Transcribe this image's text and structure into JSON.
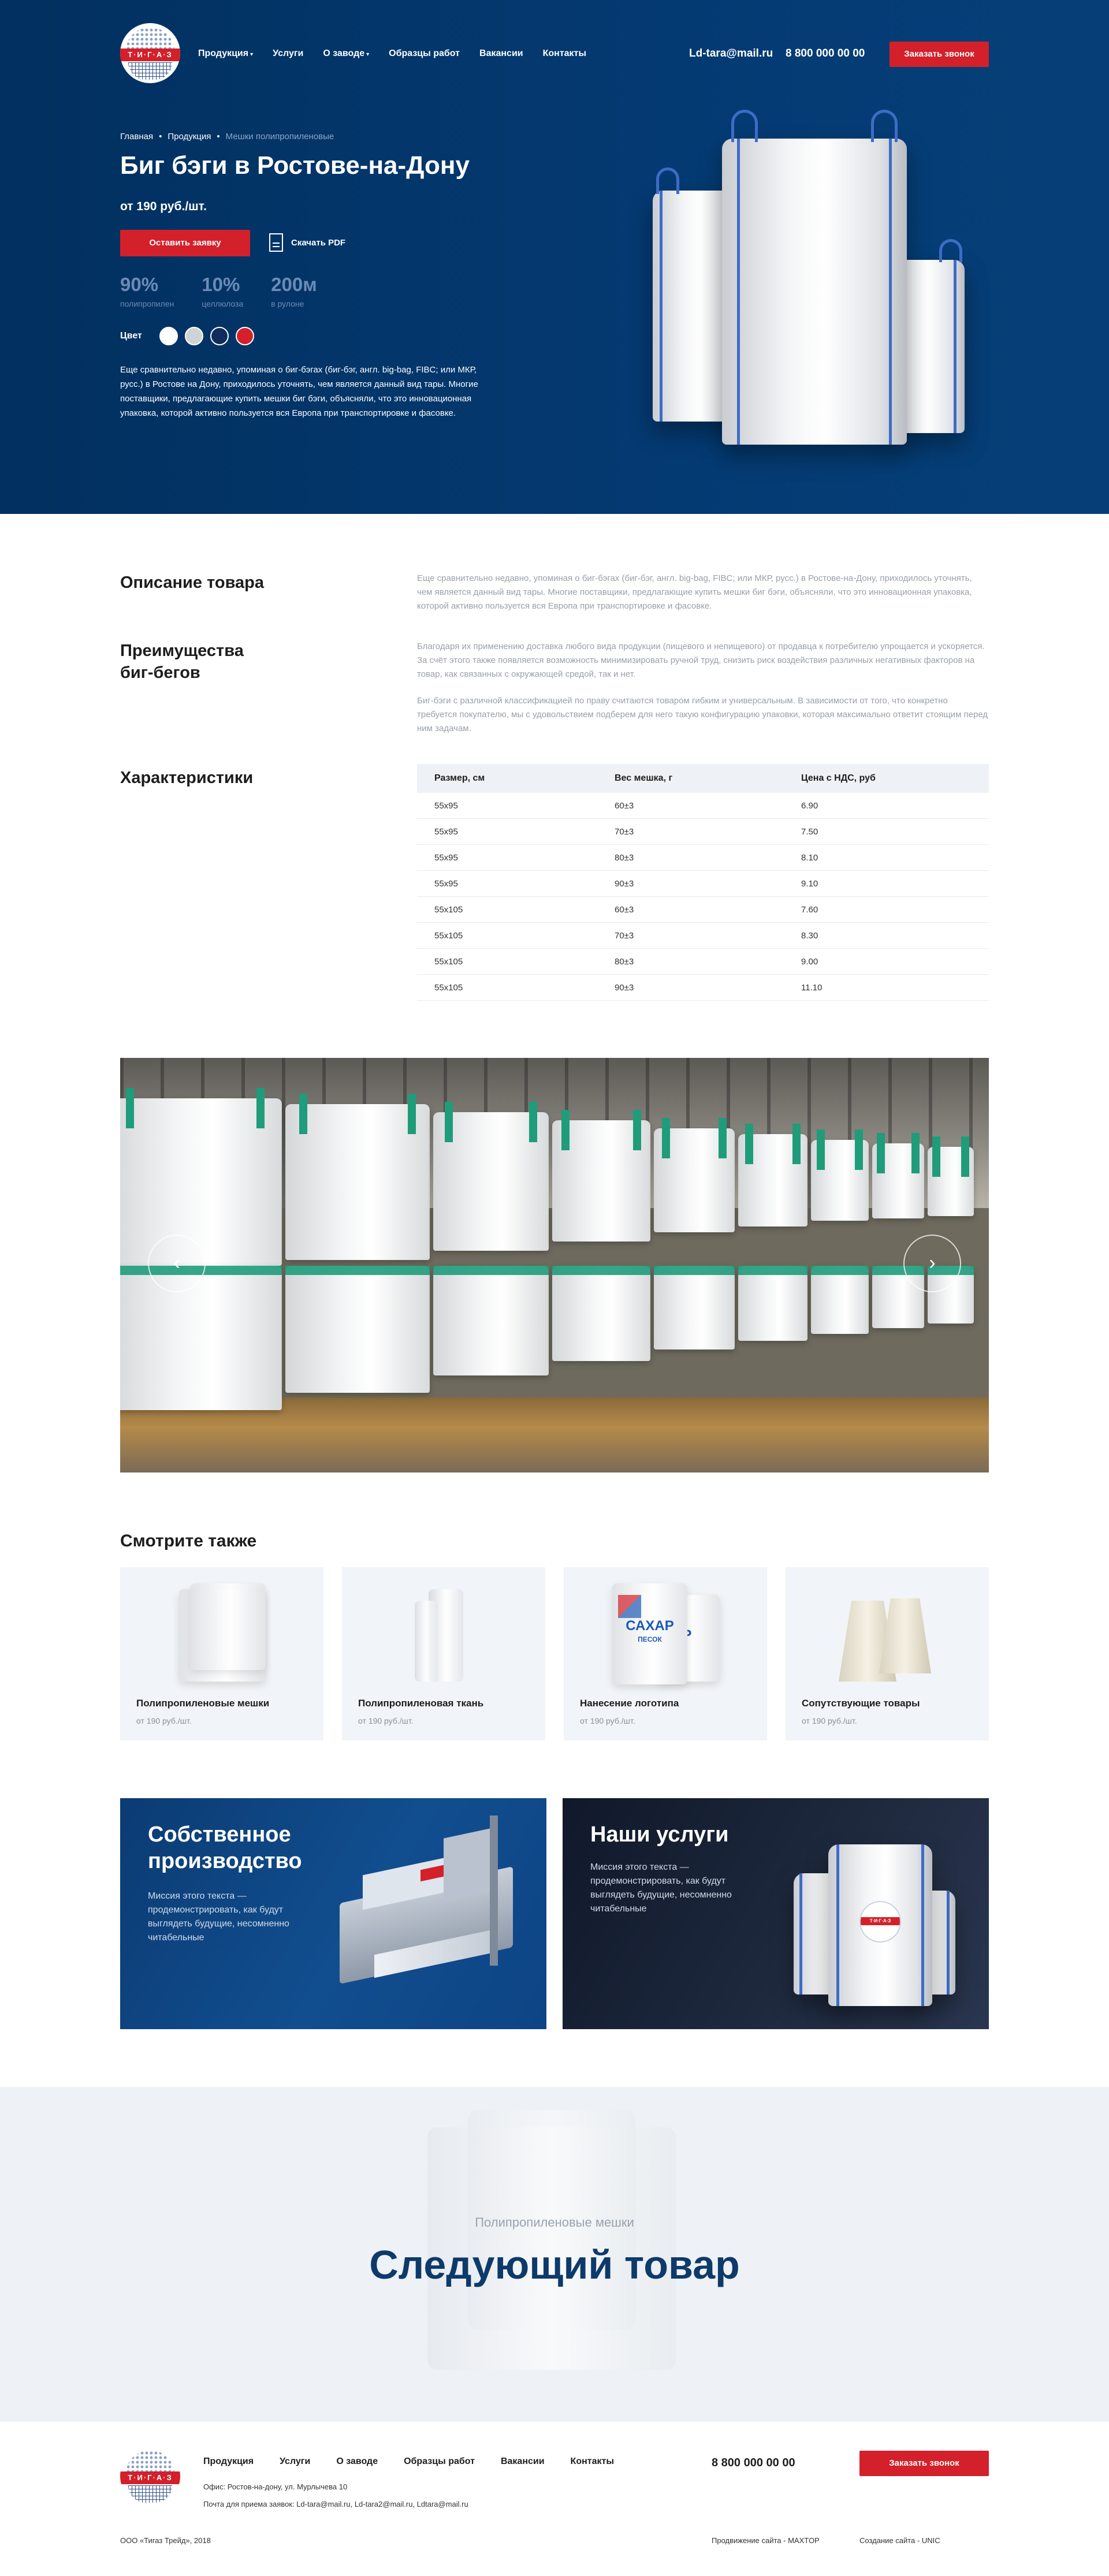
{
  "header": {
    "logo_text": "Т·И·Г·А·З",
    "nav": [
      {
        "label": "Продукция",
        "dropdown": true
      },
      {
        "label": "Услуги",
        "dropdown": false
      },
      {
        "label": "О заводе",
        "dropdown": true
      },
      {
        "label": "Образцы работ",
        "dropdown": false
      },
      {
        "label": "Вакансии",
        "dropdown": false
      },
      {
        "label": "Контакты",
        "dropdown": false
      }
    ],
    "email": "Ld-tara@mail.ru",
    "phone": "8 800 000 00 00",
    "call_button": "Заказать звонок"
  },
  "hero": {
    "breadcrumbs": [
      "Главная",
      "Продукция",
      "Мешки полипропиленовые"
    ],
    "title": "Биг бэги в Ростове-на-Дону",
    "price": "от 190 руб./шт.",
    "order_button": "Оставить заявку",
    "pdf_link": "Скачать PDF",
    "stats": [
      {
        "value": "90%",
        "label": "полипропилен"
      },
      {
        "value": "10%",
        "label": "целлюлоза"
      },
      {
        "value": "200м",
        "label": "в рулоне"
      }
    ],
    "color_label": "Цвет",
    "colors": [
      "#ffffff",
      "#cfd3d6",
      "#0e2d5c",
      "#d3202a"
    ],
    "description": "Еще сравнительно недавно, упоминая о биг-бэгах (биг-бэг, англ. big-bag, FIBC; или МКР, русс.) в Ростове на Дону, приходилось уточнять, чем является данный вид тары. Многие поставщики, предлагающие купить мешки биг бэги, объясняли, что это инновационная упаковка, которой активно пользуется вся Европа при транспортировке и фасовке."
  },
  "description_section": {
    "title": "Описание товара",
    "text": "Еще сравнительно недавно, упоминая о биг-бэгах (биг-бэг, англ. big-bag, FIBC; или МКР, русс.) в Ростове-на-Дону, приходилось уточнять, чем является данный вид тары. Многие поставщики, предлагающие купить мешки биг бэги, объясняли, что это инновационная упаковка, которой активно пользуется вся Европа при транспортировке и фасовке."
  },
  "advantages_section": {
    "title_line1": "Преимущества",
    "title_line2": "биг-бегов",
    "text1": "Благодаря их применению доставка любого вида продукции (пищевого и непищевого) от продавца к потребителю упрощается и ускоряется. За счёт этого также появляется возможность минимизировать ручной труд, снизить риск воздействия различных негативных факторов на товар, как связанных с окружающей средой, так и нет.",
    "text2": "Биг-бэги с различной классификацией по праву считаются товаром гибким и универсальным. В зависимости от того, что конкретно требуется покупателю, мы с удовольствием подберем для него такую конфигурацию упаковки, которая максимально ответит стоящим перед ним задачам."
  },
  "specs": {
    "title": "Характеристики",
    "columns": [
      "Размер, см",
      "Вес мешка, г",
      "Цена с НДС, руб"
    ],
    "rows": [
      [
        "55х95",
        "60±3",
        "6.90"
      ],
      [
        "55х95",
        "70±3",
        "7.50"
      ],
      [
        "55х95",
        "80±3",
        "8.10"
      ],
      [
        "55х95",
        "90±3",
        "9.10"
      ],
      [
        "55х105",
        "60±3",
        "7.60"
      ],
      [
        "55х105",
        "70±3",
        "8.30"
      ],
      [
        "55х105",
        "80±3",
        "9.00"
      ],
      [
        "55х105",
        "90±3",
        "11.10"
      ]
    ]
  },
  "gallery": {
    "prev": "‹",
    "next": "›"
  },
  "see_also": {
    "title": "Смотрите также",
    "cards": [
      {
        "name": "Полипропиленовые мешки",
        "price": "от 190 руб./шт."
      },
      {
        "name": "Полипропиленовая ткань",
        "price": "от 190 руб./шт."
      },
      {
        "name": "Нанесение логотипа",
        "price": "от 190 руб./шт."
      },
      {
        "name": "Сопутствующие товары",
        "price": "от 190 руб./шт."
      }
    ],
    "sugar_word": "САХАР",
    "sugar_sub": "ПЕСОК",
    "sugar_word2": "АР"
  },
  "promo": {
    "production": {
      "title_line1": "Собственное",
      "title_line2": "производство",
      "text": "Миссия этого текста — продемонстрировать, как будут выглядеть будущие, несомненно читабельные"
    },
    "services": {
      "title": "Наши услуги",
      "text": "Миссия этого текста — продемонстрировать, как будут выглядеть будущие, несомненно читабельные"
    }
  },
  "next_product": {
    "kicker": "Полипропиленовые мешки",
    "title": "Следующий товар"
  },
  "footer": {
    "nav": [
      "Продукция",
      "Услуги",
      "О заводе",
      "Образцы работ",
      "Вакансии",
      "Контакты"
    ],
    "office": "Офис: Ростов-на-дону, ул. Мурлычева 10",
    "emails": "Почта для приема заявок: Ld-tara@mail.ru, Ld-tara2@mail.ru, Ldtara@mail.ru",
    "phone": "8 800 000 00 00",
    "call_button": "Заказать звонок",
    "copyright": "ООО «Тигаз Трейд», 2018",
    "promotion": "Продвижение сайта - MAXTOP",
    "creation": "Создание сайта - UNIC"
  }
}
